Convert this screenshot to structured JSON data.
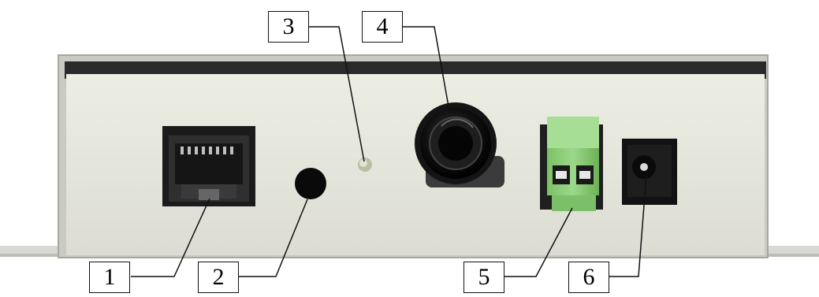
{
  "callouts": [
    {
      "id": "1",
      "label": "1"
    },
    {
      "id": "2",
      "label": "2"
    },
    {
      "id": "3",
      "label": "3"
    },
    {
      "id": "4",
      "label": "4"
    },
    {
      "id": "5",
      "label": "5"
    },
    {
      "id": "6",
      "label": "6"
    }
  ],
  "colors": {
    "panel_face": "#e6e7dd",
    "panel_shadow": "#2a2a2a",
    "led": "#cbd2b8",
    "terminal_block": "#8fcf7a",
    "connector_dark": "#1b1b1b",
    "button": "#0a0a0a"
  }
}
